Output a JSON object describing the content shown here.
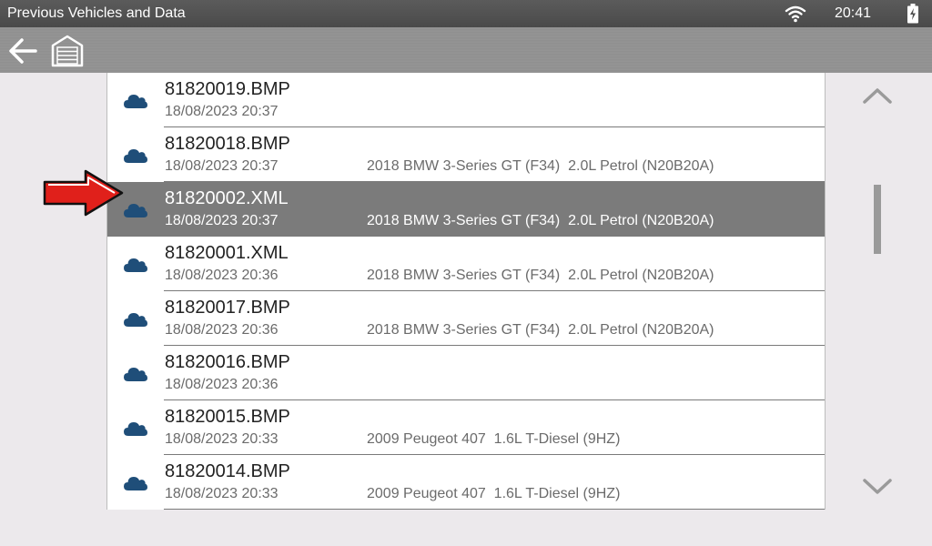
{
  "status_bar": {
    "title": "Previous Vehicles and Data",
    "time": "20:41",
    "wifi_icon": "wifi-icon",
    "battery_icon": "battery-charging-icon"
  },
  "toolbar": {
    "back_icon": "back-arrow-icon",
    "garage_icon": "garage-icon"
  },
  "colors": {
    "selected_row": "#7b7b7b",
    "cloud_icon": "#1f4e79",
    "annotation_arrow": "#e0201b"
  },
  "records": [
    {
      "name": "81820019.BMP",
      "date": "18/08/2023 20:37",
      "vehicle": "",
      "selected": false
    },
    {
      "name": "81820018.BMP",
      "date": "18/08/2023 20:37",
      "vehicle": "2018 BMW 3-Series GT (F34)  2.0L Petrol (N20B20A)",
      "selected": false
    },
    {
      "name": "81820002.XML",
      "date": "18/08/2023 20:37",
      "vehicle": "2018 BMW 3-Series GT (F34)  2.0L Petrol (N20B20A)",
      "selected": true
    },
    {
      "name": "81820001.XML",
      "date": "18/08/2023 20:36",
      "vehicle": "2018 BMW 3-Series GT (F34)  2.0L Petrol (N20B20A)",
      "selected": false
    },
    {
      "name": "81820017.BMP",
      "date": "18/08/2023 20:36",
      "vehicle": "2018 BMW 3-Series GT (F34)  2.0L Petrol (N20B20A)",
      "selected": false
    },
    {
      "name": "81820016.BMP",
      "date": "18/08/2023 20:36",
      "vehicle": "",
      "selected": false
    },
    {
      "name": "81820015.BMP",
      "date": "18/08/2023 20:33",
      "vehicle": "2009 Peugeot 407  1.6L T-Diesel (9HZ)",
      "selected": false
    },
    {
      "name": "81820014.BMP",
      "date": "18/08/2023 20:33",
      "vehicle": "2009 Peugeot 407  1.6L T-Diesel (9HZ)",
      "selected": false
    }
  ]
}
